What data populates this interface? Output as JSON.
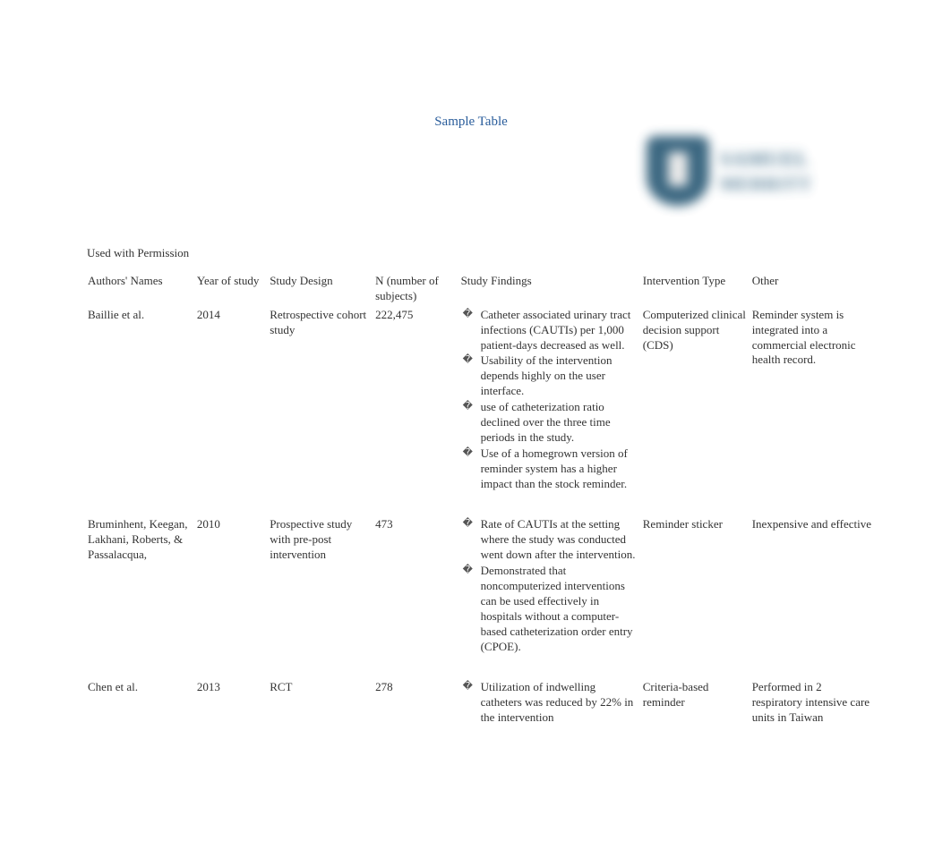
{
  "logo": {
    "line1": "SAMUEL",
    "line2": "MERRITT"
  },
  "title": "Sample Table",
  "permission": "Used with Permission",
  "headers": {
    "authors": "Authors' Names",
    "year": "Year of study",
    "design": "Study Design",
    "n": "N (number of subjects)",
    "findings": "Study Findings",
    "intervention": "Intervention Type",
    "other": "Other"
  },
  "rows": [
    {
      "authors": "Baillie et al.",
      "year": "2014",
      "design": "Retrospective cohort study",
      "n": "222,475",
      "findings": [
        "Catheter associated urinary tract infections (CAUTIs) per 1,000 patient-days decreased as well.",
        "Usability of the intervention depends highly on the user interface.",
        "use of catheterization ratio declined over the three time periods in the study.",
        "Use of a homegrown version of reminder system has a higher impact than the stock reminder."
      ],
      "intervention": "Computerized clinical decision support (CDS)",
      "other": "Reminder system is integrated into a commercial electronic health record."
    },
    {
      "authors": "Bruminhent, Keegan, Lakhani, Roberts, & Passalacqua,",
      "year": "2010",
      "design": "Prospective study with pre-post intervention",
      "n": "473",
      "findings": [
        "Rate of CAUTIs at the setting where the study was conducted went down after the intervention.",
        "Demonstrated that noncomputerized interventions can be used effectively in hospitals without a computer-based catheterization order entry (CPOE)."
      ],
      "intervention": "Reminder sticker",
      "other": "Inexpensive and effective"
    },
    {
      "authors": "Chen et al.",
      "year": "2013",
      "design": "RCT",
      "n": "278",
      "findings": [
        "Utilization of indwelling catheters was reduced by 22% in the intervention"
      ],
      "intervention": "Criteria-based reminder",
      "other": "Performed in 2 respiratory intensive care units in Taiwan"
    }
  ]
}
